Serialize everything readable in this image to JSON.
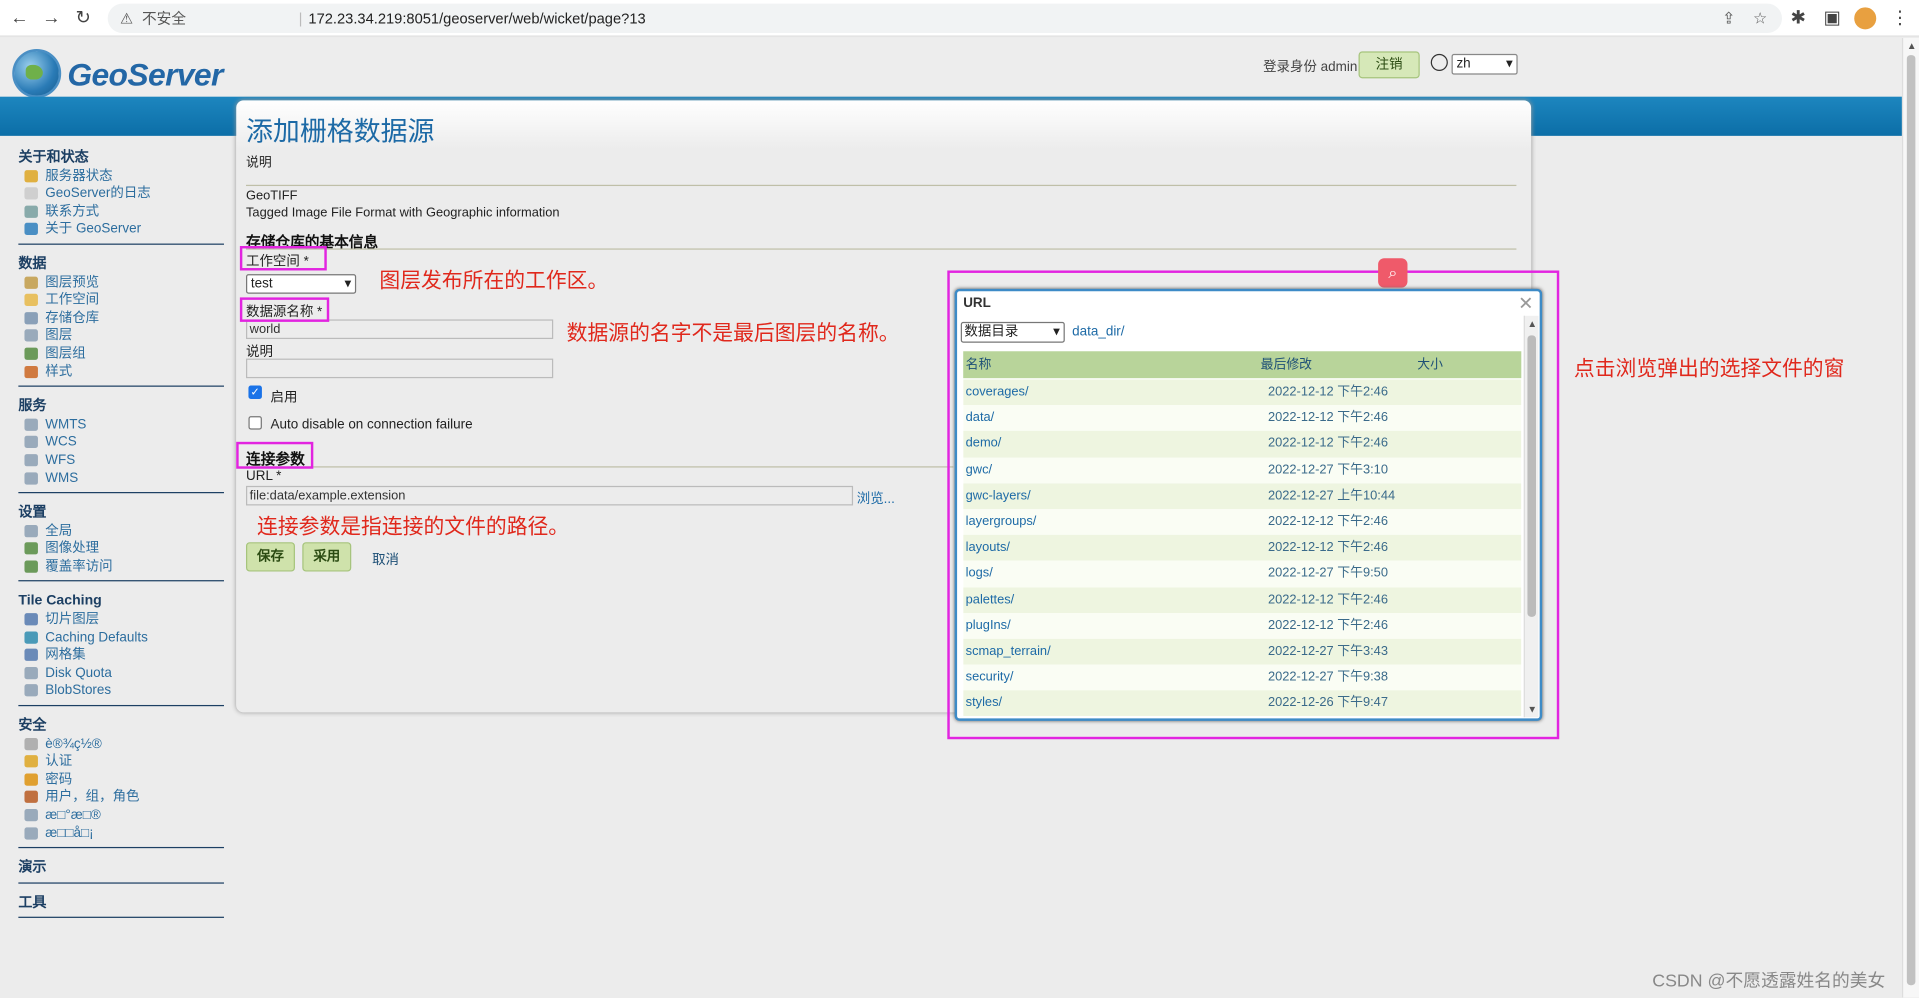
{
  "browser": {
    "insecure": "不安全",
    "url": "172.23.34.219:8051/geoserver/web/wicket/page?13"
  },
  "header": {
    "logo_text": "GeoServer",
    "login_text": "登录身份 admin.",
    "logout_label": "注销",
    "lang": "zh"
  },
  "sidebar": {
    "groups": [
      {
        "title": "关于和状态",
        "items": [
          {
            "label": "服务器状态",
            "color": "#e0b040"
          },
          {
            "label": "GeoServer的日志",
            "color": "#cfcfcf"
          },
          {
            "label": "联系方式",
            "color": "#8aa"
          },
          {
            "label": "关于 GeoServer",
            "color": "#4a8fc4"
          }
        ]
      },
      {
        "title": "数据",
        "items": [
          {
            "label": "图层预览",
            "color": "#c8a860"
          },
          {
            "label": "工作空间",
            "color": "#e8c060"
          },
          {
            "label": "存储仓库",
            "color": "#8aa0b8"
          },
          {
            "label": "图层",
            "color": "#9ab"
          },
          {
            "label": "图层组",
            "color": "#6b9a5a"
          },
          {
            "label": "样式",
            "color": "#d07a40"
          }
        ]
      },
      {
        "title": "服务",
        "items": [
          {
            "label": "WMTS",
            "color": "#9ab"
          },
          {
            "label": "WCS",
            "color": "#9ab"
          },
          {
            "label": "WFS",
            "color": "#9ab"
          },
          {
            "label": "WMS",
            "color": "#9ab"
          }
        ]
      },
      {
        "title": "设置",
        "items": [
          {
            "label": "全局",
            "color": "#9ab"
          },
          {
            "label": "图像处理",
            "color": "#6b9a5a"
          },
          {
            "label": "覆盖率访问",
            "color": "#6b9a5a"
          }
        ]
      },
      {
        "title": "Tile Caching",
        "items": [
          {
            "label": "切片图层",
            "color": "#6a8ab8"
          },
          {
            "label": "Caching Defaults",
            "color": "#4a9ab8"
          },
          {
            "label": "网格集",
            "color": "#6a8ab8"
          },
          {
            "label": "Disk Quota",
            "color": "#9ab"
          },
          {
            "label": "BlobStores",
            "color": "#9ab"
          }
        ]
      },
      {
        "title": "安全",
        "items": [
          {
            "label": "è®¾ç½®",
            "color": "#b0b0b0"
          },
          {
            "label": "认证",
            "color": "#e0b040"
          },
          {
            "label": "密码",
            "color": "#e0a030"
          },
          {
            "label": "用户，组，角色",
            "color": "#c07040"
          },
          {
            "label": "æ□°æ□®",
            "color": "#9ab"
          },
          {
            "label": "æ□□å□¡",
            "color": "#9ab"
          }
        ]
      },
      {
        "title": "演示",
        "items": []
      },
      {
        "title": "工具",
        "items": []
      }
    ]
  },
  "form": {
    "title": "添加栅格数据源",
    "desc_label": "说明",
    "store_type": "GeoTIFF",
    "store_desc": "Tagged Image File Format with Geographic information",
    "section_basic": "存储仓库的基本信息",
    "workspace_label": "工作空间 *",
    "workspace_value": "test",
    "name_label": "数据源名称 *",
    "name_value": "world",
    "description_label": "说明",
    "description_value": "",
    "enabled_label": "启用",
    "autodisable_label": "Auto disable on connection failure",
    "section_conn": "连接参数",
    "url_label": "URL *",
    "url_value": "file:data/example.extension",
    "browse_label": "浏览...",
    "save_label": "保存",
    "apply_label": "采用",
    "cancel_label": "取消"
  },
  "annotations": {
    "workspace": "图层发布所在的工作区。",
    "name": "数据源的名字不是最后图层的名称。",
    "conn": "连接参数是指连接的文件的路径。",
    "browse": "点击浏览弹出的选择文件的窗"
  },
  "popup": {
    "title": "URL",
    "dir_select": "数据目录",
    "path": "data_dir/",
    "col_name": "名称",
    "col_modified": "最后修改",
    "col_size": "大小",
    "rows": [
      {
        "name": "coverages/",
        "modified": "2022-12-12 下午2:46"
      },
      {
        "name": "data/",
        "modified": "2022-12-12 下午2:46"
      },
      {
        "name": "demo/",
        "modified": "2022-12-12 下午2:46"
      },
      {
        "name": "gwc/",
        "modified": "2022-12-27 下午3:10"
      },
      {
        "name": "gwc-layers/",
        "modified": "2022-12-27 上午10:44"
      },
      {
        "name": "layergroups/",
        "modified": "2022-12-12 下午2:46"
      },
      {
        "name": "layouts/",
        "modified": "2022-12-12 下午2:46"
      },
      {
        "name": "logs/",
        "modified": "2022-12-27 下午9:50"
      },
      {
        "name": "palettes/",
        "modified": "2022-12-12 下午2:46"
      },
      {
        "name": "plugIns/",
        "modified": "2022-12-12 下午2:46"
      },
      {
        "name": "scmap_terrain/",
        "modified": "2022-12-27 下午3:43"
      },
      {
        "name": "security/",
        "modified": "2022-12-27 下午9:38"
      },
      {
        "name": "styles/",
        "modified": "2022-12-26 下午9:47"
      }
    ]
  },
  "watermark": "CSDN @不愿透露姓名的美女"
}
